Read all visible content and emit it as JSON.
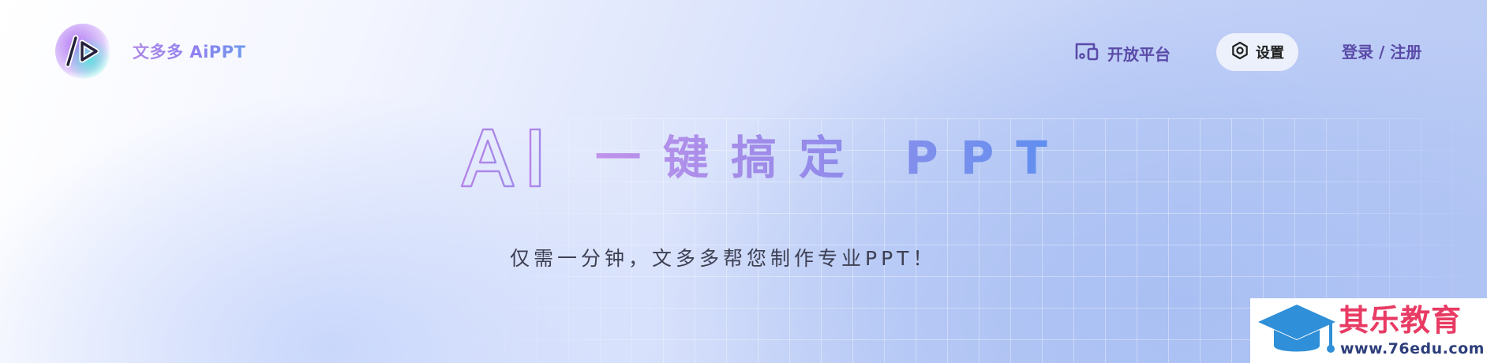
{
  "header": {
    "brand_name": "文多多 AiPPT",
    "nav": {
      "open_platform_label": "开放平台",
      "settings_label": "设置",
      "login_label": "登录 / 注册"
    }
  },
  "hero": {
    "title_ai": "AI",
    "title_rest": "一键搞定 PPT",
    "subtitle": "仅需一分钟，文多多帮您制作专业PPT！"
  },
  "watermark": {
    "title": "其乐教育",
    "url": "www.76edu.com"
  },
  "colors": {
    "accent_purple": "#5a4aa8",
    "gradient_start": "#c093ea",
    "gradient_end": "#5b8ff0",
    "watermark_red": "#e83b64",
    "watermark_blue": "#2f8fd8"
  }
}
